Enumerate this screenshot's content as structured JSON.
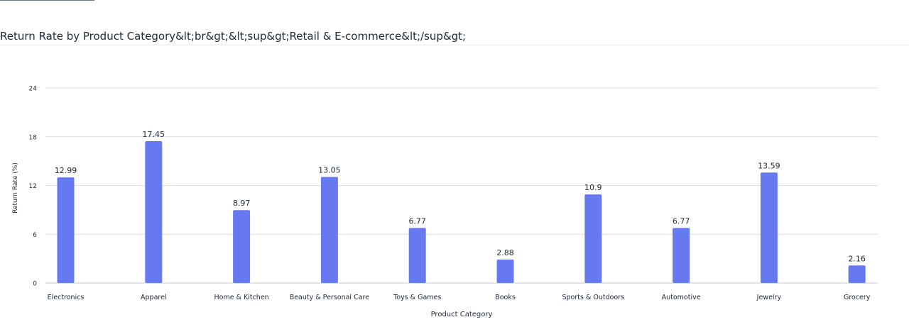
{
  "page": {
    "title": "Return Rate by Product Category&lt;br&gt;&lt;sup&gt;Retail & E-commerce&lt;/sup&gt;"
  },
  "colors": {
    "bar": "#6779f1",
    "grid": "#dcdfe4",
    "axis_text": "#1f2937"
  },
  "chart_data": {
    "type": "bar",
    "title": "Return Rate by Product Category&lt;br&gt;&lt;sup&gt;Retail & E-commerce&lt;/sup&gt;",
    "xlabel": "Product Category",
    "ylabel": "Return Rate (%)",
    "categories": [
      "Electronics",
      "Apparel",
      "Home & Kitchen",
      "Beauty & Personal Care",
      "Toys & Games",
      "Books",
      "Sports & Outdoors",
      "Automotive",
      "Jewelry",
      "Grocery"
    ],
    "values": [
      12.99,
      17.45,
      8.97,
      13.05,
      6.77,
      2.88,
      10.9,
      6.77,
      13.59,
      2.16
    ],
    "ylim": [
      0,
      24
    ],
    "yticks": [
      0,
      6,
      12,
      18,
      24
    ],
    "grid": true,
    "data_labels": true,
    "legend": "none"
  }
}
